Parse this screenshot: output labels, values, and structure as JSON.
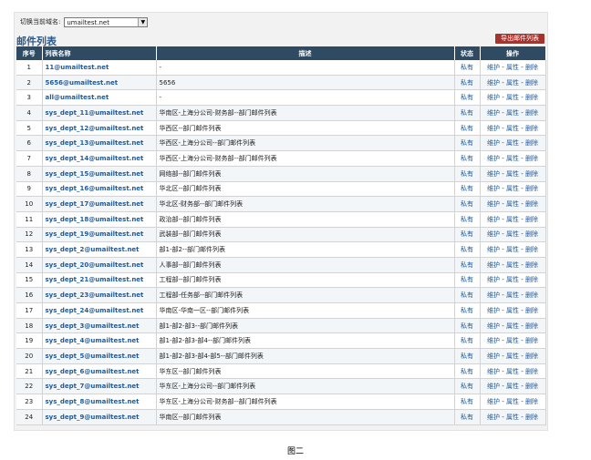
{
  "domain_switch": {
    "label": "切换当前域名:",
    "selected": "umailtest.net"
  },
  "page_title": "邮件列表",
  "export_button": "导出邮件列表",
  "columns": [
    "序号",
    "列表名称",
    "描述",
    "状态",
    "操作"
  ],
  "ops": {
    "maintain": "维护",
    "props": "属性",
    "delete": "删除",
    "sep": " - "
  },
  "rows": [
    {
      "no": "1",
      "name": "11@umailtest.net",
      "desc": "-",
      "state": "私有"
    },
    {
      "no": "2",
      "name": "5656@umailtest.net",
      "desc": "5656",
      "state": "私有"
    },
    {
      "no": "3",
      "name": "all@umailtest.net",
      "desc": "-",
      "state": "私有"
    },
    {
      "no": "4",
      "name": "sys_dept_11@umailtest.net",
      "desc": "华南区-上海分公司-财务部--部门邮件列表",
      "state": "私有"
    },
    {
      "no": "5",
      "name": "sys_dept_12@umailtest.net",
      "desc": "华西区--部门邮件列表",
      "state": "私有"
    },
    {
      "no": "6",
      "name": "sys_dept_13@umailtest.net",
      "desc": "华西区-上海分公司--部门邮件列表",
      "state": "私有"
    },
    {
      "no": "7",
      "name": "sys_dept_14@umailtest.net",
      "desc": "华西区-上海分公司-财务部--部门邮件列表",
      "state": "私有"
    },
    {
      "no": "8",
      "name": "sys_dept_15@umailtest.net",
      "desc": "网络部--部门邮件列表",
      "state": "私有"
    },
    {
      "no": "9",
      "name": "sys_dept_16@umailtest.net",
      "desc": "华北区--部门邮件列表",
      "state": "私有"
    },
    {
      "no": "10",
      "name": "sys_dept_17@umailtest.net",
      "desc": "华北区-财务部--部门邮件列表",
      "state": "私有"
    },
    {
      "no": "11",
      "name": "sys_dept_18@umailtest.net",
      "desc": "政治部--部门邮件列表",
      "state": "私有"
    },
    {
      "no": "12",
      "name": "sys_dept_19@umailtest.net",
      "desc": "武装部--部门邮件列表",
      "state": "私有"
    },
    {
      "no": "13",
      "name": "sys_dept_2@umailtest.net",
      "desc": "部1-部2--部门邮件列表",
      "state": "私有"
    },
    {
      "no": "14",
      "name": "sys_dept_20@umailtest.net",
      "desc": "人事部--部门邮件列表",
      "state": "私有"
    },
    {
      "no": "15",
      "name": "sys_dept_21@umailtest.net",
      "desc": "工程部--部门邮件列表",
      "state": "私有"
    },
    {
      "no": "16",
      "name": "sys_dept_23@umailtest.net",
      "desc": "工程部-任务部--部门邮件列表",
      "state": "私有"
    },
    {
      "no": "17",
      "name": "sys_dept_24@umailtest.net",
      "desc": "华南区-华南一区--部门邮件列表",
      "state": "私有"
    },
    {
      "no": "18",
      "name": "sys_dept_3@umailtest.net",
      "desc": "部1-部2-部3--部门邮件列表",
      "state": "私有"
    },
    {
      "no": "19",
      "name": "sys_dept_4@umailtest.net",
      "desc": "部1-部2-部3-部4--部门邮件列表",
      "state": "私有"
    },
    {
      "no": "20",
      "name": "sys_dept_5@umailtest.net",
      "desc": "部1-部2-部3-部4-部5--部门邮件列表",
      "state": "私有"
    },
    {
      "no": "21",
      "name": "sys_dept_6@umailtest.net",
      "desc": "华东区--部门邮件列表",
      "state": "私有"
    },
    {
      "no": "22",
      "name": "sys_dept_7@umailtest.net",
      "desc": "华东区-上海分公司--部门邮件列表",
      "state": "私有"
    },
    {
      "no": "23",
      "name": "sys_dept_8@umailtest.net",
      "desc": "华东区-上海分公司-财务部--部门邮件列表",
      "state": "私有"
    },
    {
      "no": "24",
      "name": "sys_dept_9@umailtest.net",
      "desc": "华南区--部门邮件列表",
      "state": "私有"
    }
  ],
  "caption": "图二"
}
